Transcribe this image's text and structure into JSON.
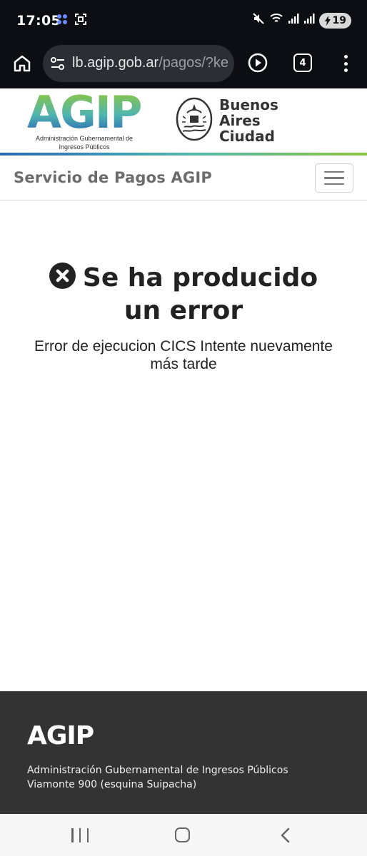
{
  "status_bar": {
    "time": "17:05",
    "battery": "19",
    "icons": [
      "app-notification-icon",
      "screenshot-icon",
      "mute-icon",
      "wifi-icon",
      "signal-icon",
      "signal-icon-2",
      "battery-icon"
    ]
  },
  "browser": {
    "url_domain": "lb.agip.gob.ar",
    "url_path": "/pagos/?ke",
    "tab_count": "4"
  },
  "header": {
    "agip_logo_text": "AGIP",
    "agip_logo_subtitle": "Administración Gubernamental de Ingresos Públicos",
    "ba_logo_line1": "Buenos",
    "ba_logo_line2": "Aires",
    "ba_logo_line3": "Ciudad"
  },
  "navbar": {
    "brand": "Servicio de Pagos AGIP"
  },
  "error": {
    "title": "Se ha producido un error",
    "message": "Error de ejecucion CICS Intente nuevamente más tarde"
  },
  "footer": {
    "logo_text": "AGIP",
    "org_name": "Administración Gubernamental de Ingresos Públicos",
    "address": "Viamonte 900 (esquina Suipacha)"
  },
  "colors": {
    "status_bar_bg": "#0c0e13",
    "footer_bg": "#333333",
    "brand_green": "#8cc641",
    "brand_teal": "#4fb5b0",
    "brand_blue": "#2b66b3"
  }
}
